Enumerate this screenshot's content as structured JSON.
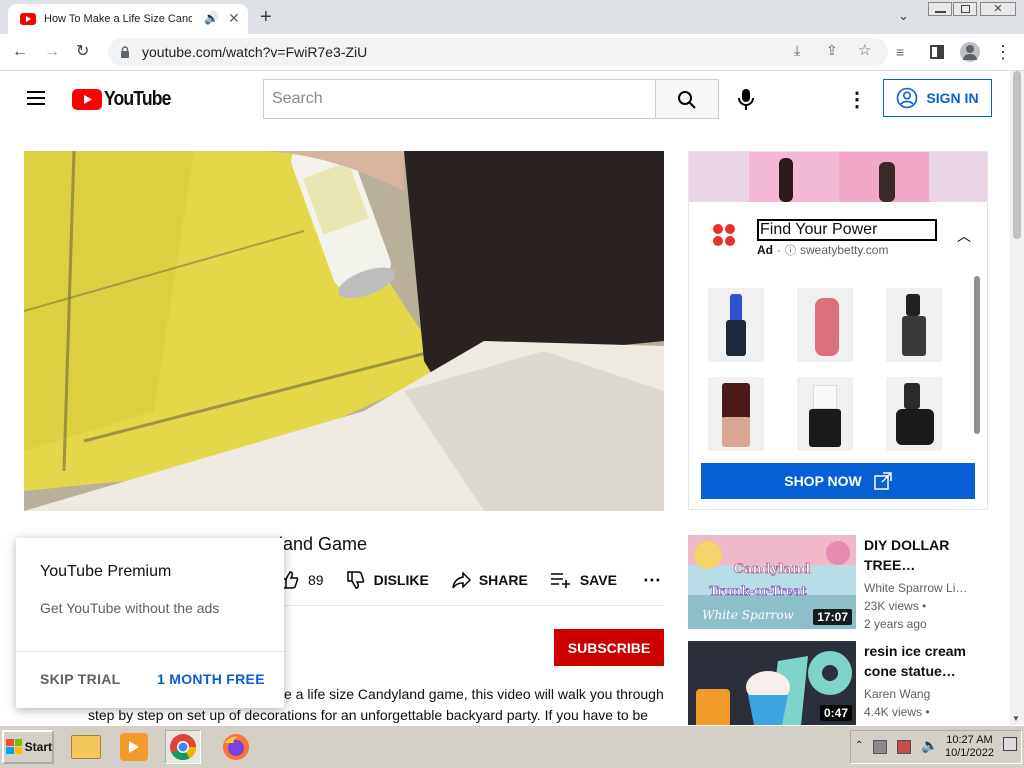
{
  "browser": {
    "tab_title": "How To Make a Life Size Candyland Game",
    "url": "youtube.com/watch?v=FwiR7e3-ZiU"
  },
  "youtube": {
    "logo_text": "YouTube",
    "search_placeholder": "Search",
    "sign_in": "SIGN IN"
  },
  "ad": {
    "headline": "Find Your Power",
    "ad_label": "Ad",
    "dot": "·",
    "domain": "sweatybetty.com",
    "cta": "SHOP NOW"
  },
  "video": {
    "title_visible": "land Game",
    "likes": "89",
    "dislike": "DISLIKE",
    "share": "SHARE",
    "save": "SAVE",
    "subscribe": "SUBSCRIBE",
    "desc_line1": "e a life size Candyland game, this video will walk you through",
    "desc_line2": "step by step on set up of decorations for an unforgettable backyard party. If you have to be"
  },
  "premium_popup": {
    "title": "YouTube Premium",
    "body": "Get YouTube without the ads",
    "skip": "SKIP TRIAL",
    "free": "1 MONTH FREE"
  },
  "recommendations": [
    {
      "title": "DIY DOLLAR TREE…",
      "channel": "White Sparrow Li…",
      "views": "23K views",
      "age": "2 years ago",
      "duration": "17:07",
      "thumb_text": "DIY Candyland Trunk-or-Treat White Sparrow"
    },
    {
      "title": "resin ice cream cone statue…",
      "channel": "Karen Wang",
      "views": "4.4K views",
      "age": "",
      "duration": "0:47"
    }
  ],
  "taskbar": {
    "start": "Start",
    "time": "10:27 AM",
    "date": "10/1/2022"
  },
  "colors": {
    "youtube_red": "#ff0000",
    "subscribe_red": "#cc0000",
    "link_blue": "#065fd4",
    "chrome_gray": "#dee1e6"
  }
}
